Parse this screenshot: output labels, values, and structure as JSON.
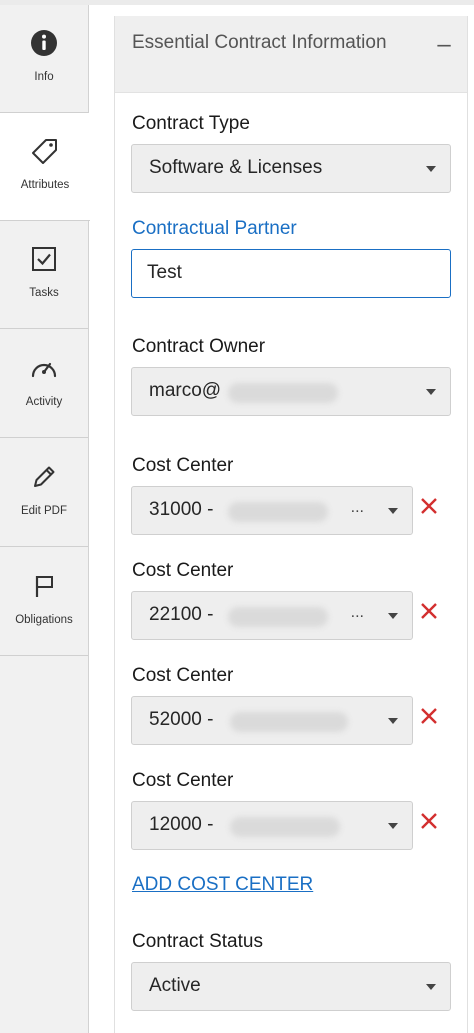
{
  "sidebar": {
    "items": [
      {
        "label": "Info",
        "icon": "info-icon"
      },
      {
        "label": "Attributes",
        "icon": "tag-icon"
      },
      {
        "label": "Tasks",
        "icon": "checkbox-icon"
      },
      {
        "label": "Activity",
        "icon": "gauge-icon"
      },
      {
        "label": "Edit PDF",
        "icon": "pencil-icon"
      },
      {
        "label": "Obligations",
        "icon": "flag-icon"
      }
    ],
    "active": "Attributes"
  },
  "panel": {
    "title": "Essential Contract Information",
    "collapse_symbol": "–"
  },
  "contract_type": {
    "label": "Contract Type",
    "value": "Software & Licenses"
  },
  "contractual_partner": {
    "label": "Contractual Partner",
    "value": "Test"
  },
  "contract_owner": {
    "label": "Contract Owner",
    "value": "marco@"
  },
  "cost_centers": [
    {
      "label": "Cost Center",
      "value": "31000 -",
      "ellipsis": "..."
    },
    {
      "label": "Cost Center",
      "value": "22100 -",
      "ellipsis": "..."
    },
    {
      "label": "Cost Center",
      "value": "52000 -",
      "ellipsis": ""
    },
    {
      "label": "Cost Center",
      "value": "12000 -",
      "ellipsis": ""
    }
  ],
  "add_cost_center_label": "ADD COST CENTER",
  "contract_status": {
    "label": "Contract Status",
    "value": "Active"
  },
  "colors": {
    "accent": "#1a6fc4",
    "remove": "#d32f2f",
    "sidebar_bg": "#f1f1f1",
    "header_bg": "#efefef"
  }
}
